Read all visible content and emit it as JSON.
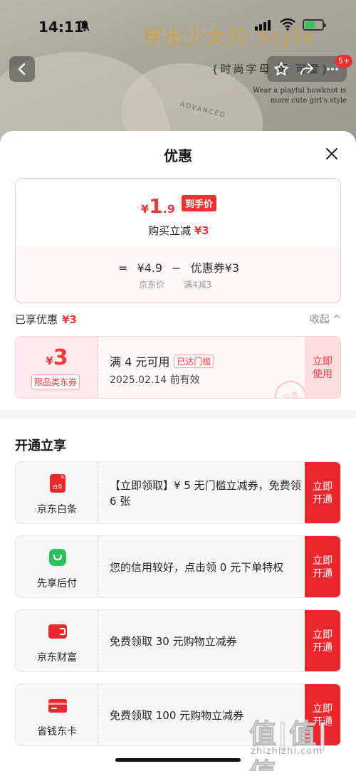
{
  "status_bar": {
    "time": "14:11"
  },
  "banner": {
    "title": "穿出少女的 Style",
    "subtitle": "{时尚字母  更  可爱}",
    "en_line1": "Wear a playful bowknot is",
    "en_line2": "more cute girl's style",
    "fabric_word": "ADVANCED",
    "cart_badge": "5+"
  },
  "sheet": {
    "title": "优惠",
    "price_card": {
      "currency": "¥",
      "price_int": "1",
      "price_dec": ".9",
      "final_tag": "到手价",
      "reduce_label": "购买立减",
      "reduce_value": "¥3",
      "formula_eq": "=",
      "formula_price": "¥4.9",
      "formula_minus": "−",
      "formula_coupon": "优惠券¥3",
      "caption_price": "京东价",
      "caption_coupon": "满4减3"
    },
    "enjoyed": {
      "label": "已享优惠",
      "value": "¥3",
      "collapse": "收起 ^"
    },
    "coupon": {
      "currency": "¥",
      "amount": "3",
      "type": "限品类东券",
      "condition": "满 4 元可用",
      "reached": "已达门槛",
      "valid": "2025.02.14 前有效",
      "use_btn": "立即使用",
      "seal": "已选"
    },
    "section_title": "开通立享",
    "offers": [
      {
        "name": "京东白条",
        "icon": "baitiao-icon",
        "icon_text": "白条",
        "desc": "【立即领取】¥ 5 无门槛立减券，免费领 6 张",
        "btn": "立即开通",
        "color": "#e8282d"
      },
      {
        "name": "先享后付",
        "icon": "shopping-bag-icon",
        "icon_text": "",
        "desc": "您的信用较好，点击领 0 元下单特权",
        "btn": "立即开通",
        "color": "#2fbf5f"
      },
      {
        "name": "京东财富",
        "icon": "wallet-icon",
        "icon_text": "",
        "desc": "免费领取 30 元购物立减券",
        "btn": "立即开通",
        "color": "#e8282d"
      },
      {
        "name": "省钱东卡",
        "icon": "card-icon",
        "icon_text": "",
        "desc": "免费领取 100 元购物立减券",
        "btn": "立即开通",
        "color": "#e8282d"
      }
    ]
  },
  "watermark": {
    "text": "值|值|值",
    "url": "zhizhizhi.com"
  }
}
